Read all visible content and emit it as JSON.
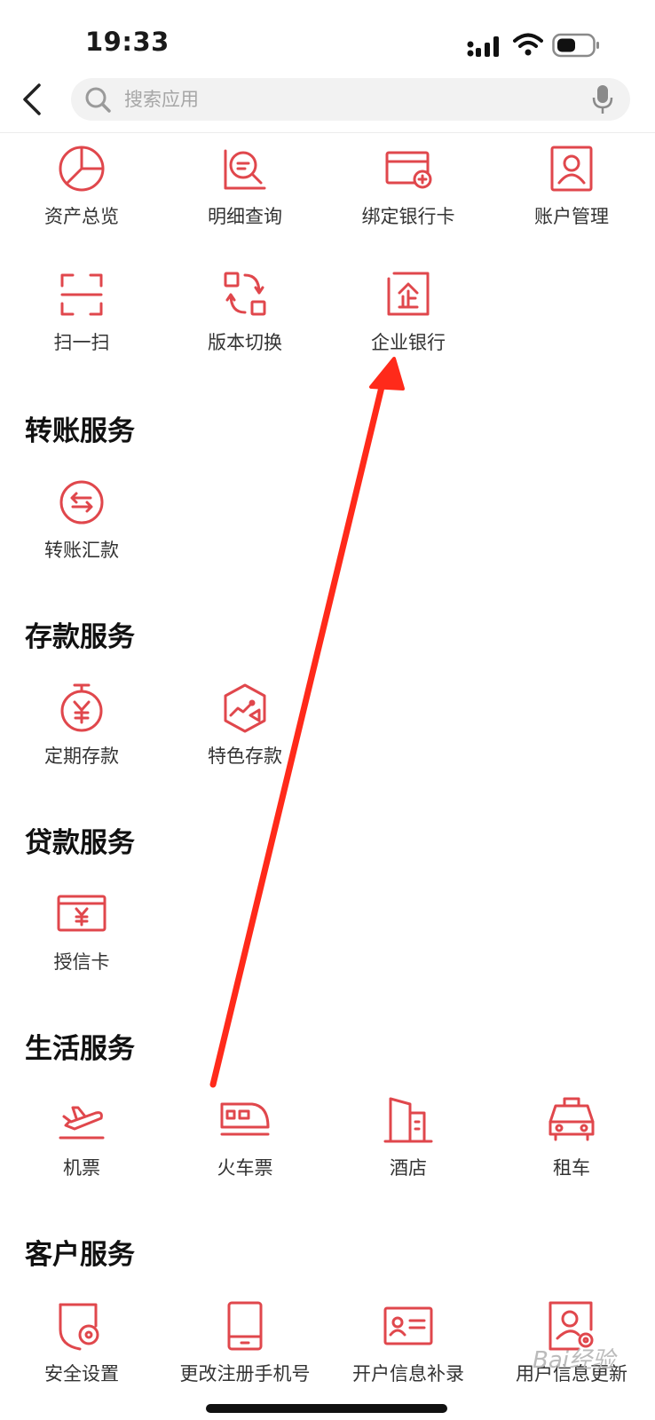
{
  "status_bar": {
    "time": "19:33"
  },
  "search": {
    "placeholder": "搜索应用"
  },
  "top_items": [
    {
      "label": "资产总览",
      "icon": "pie-chart-icon"
    },
    {
      "label": "明细查询",
      "icon": "detail-search-icon"
    },
    {
      "label": "绑定银行卡",
      "icon": "bind-card-icon"
    },
    {
      "label": "账户管理",
      "icon": "account-icon"
    },
    {
      "label": "扫一扫",
      "icon": "scan-icon"
    },
    {
      "label": "版本切换",
      "icon": "switch-icon"
    },
    {
      "label": "企业银行",
      "icon": "enterprise-bank-icon"
    }
  ],
  "sections": {
    "transfer": {
      "title": "转账服务",
      "items": [
        {
          "label": "转账汇款",
          "icon": "transfer-icon"
        }
      ]
    },
    "deposit": {
      "title": "存款服务",
      "items": [
        {
          "label": "定期存款",
          "icon": "timer-yen-icon"
        },
        {
          "label": "特色存款",
          "icon": "featured-deposit-icon"
        }
      ]
    },
    "loan": {
      "title": "贷款服务",
      "items": [
        {
          "label": "授信卡",
          "icon": "credit-card-yen-icon"
        }
      ]
    },
    "life": {
      "title": "生活服务",
      "items": [
        {
          "label": "机票",
          "icon": "plane-icon"
        },
        {
          "label": "火车票",
          "icon": "train-icon"
        },
        {
          "label": "酒店",
          "icon": "hotel-icon"
        },
        {
          "label": "租车",
          "icon": "taxi-icon"
        }
      ]
    },
    "customer": {
      "title": "客户服务",
      "items": [
        {
          "label": "安全设置",
          "icon": "security-settings-icon"
        },
        {
          "label": "更改注册手机号",
          "icon": "phone-icon"
        },
        {
          "label": "开户信息补录",
          "icon": "id-card-icon"
        },
        {
          "label": "用户信息更新",
          "icon": "user-update-icon"
        }
      ]
    }
  },
  "watermark": {
    "text": "Bai经验"
  },
  "colors": {
    "accent": "#e0474c",
    "annotation": "#ff2a1a"
  }
}
